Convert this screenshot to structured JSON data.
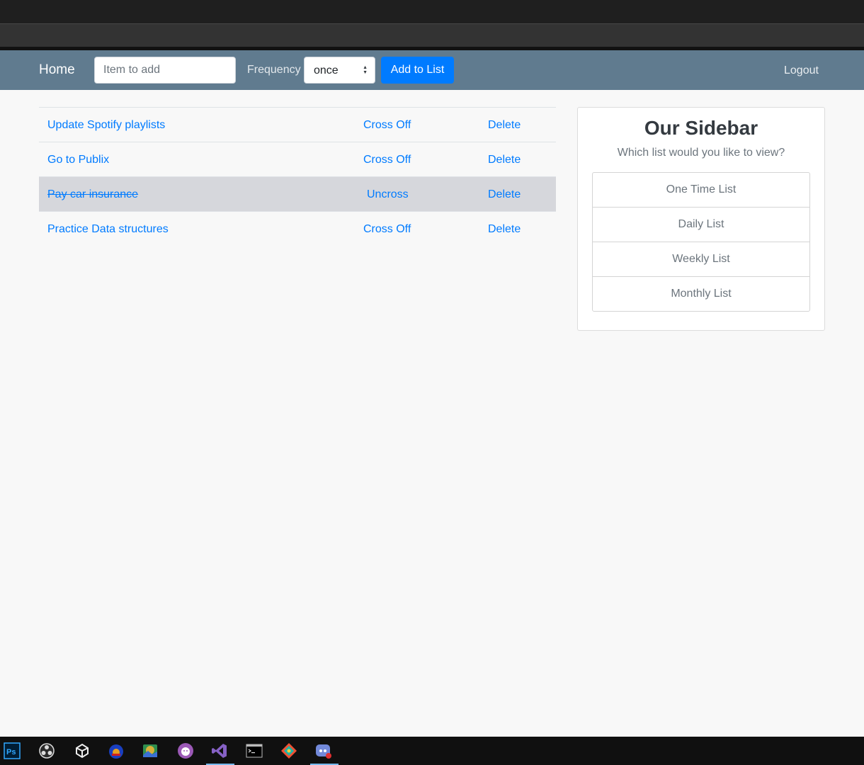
{
  "navbar": {
    "brand": "Home",
    "item_placeholder": "Item to add",
    "frequency_label": "Frequency",
    "frequency_value": "once",
    "add_button": "Add to List",
    "logout": "Logout"
  },
  "todos": [
    {
      "name": "Update Spotify playlists",
      "action": "Cross Off",
      "delete": "Delete",
      "crossed": false
    },
    {
      "name": "Go to Publix",
      "action": "Cross Off",
      "delete": "Delete",
      "crossed": false
    },
    {
      "name": "Pay car insurance",
      "action": "Uncross",
      "delete": "Delete",
      "crossed": true
    },
    {
      "name": "Practice Data structures",
      "action": "Cross Off",
      "delete": "Delete",
      "crossed": false
    }
  ],
  "sidebar": {
    "title": "Our Sidebar",
    "subtitle": "Which list would you like to view?",
    "lists": [
      "One Time List",
      "Daily List",
      "Weekly List",
      "Monthly List"
    ]
  },
  "taskbar": {
    "icons": [
      "photoshop-icon",
      "obs-icon",
      "unity-icon",
      "app-icon",
      "image-viewer-icon",
      "github-desktop-icon",
      "visual-studio-icon",
      "terminal-icon",
      "git-kraken-icon",
      "discord-icon"
    ],
    "active": "visual-studio-icon"
  },
  "colors": {
    "navbar_bg": "#607b8f",
    "primary": "#007bff",
    "crossed_row_bg": "#d6d7dc",
    "page_bg": "#f8f8f8"
  }
}
